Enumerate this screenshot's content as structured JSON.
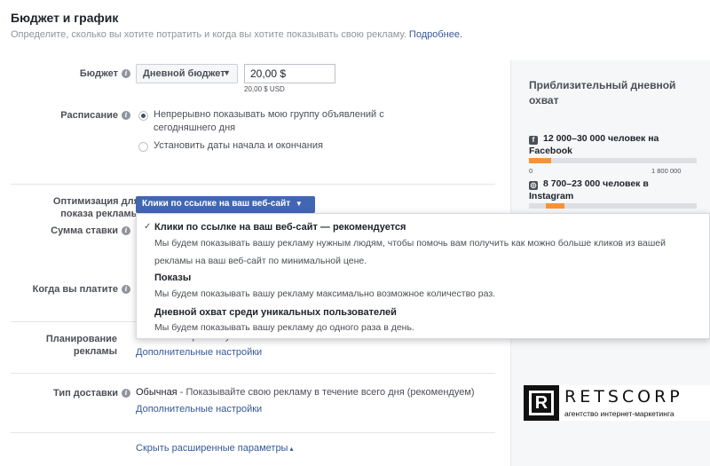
{
  "header": {
    "title": "Бюджет и график",
    "description": "Определите, сколько вы хотите потратить и когда вы хотите показывать свою рекламу.",
    "learn_more": "Подробнее."
  },
  "budget": {
    "label": "Бюджет",
    "type_selected": "Дневной бюджет",
    "amount": "20,00 $",
    "amount_usd": "20,00 $ USD"
  },
  "schedule": {
    "label": "Расписание",
    "options": [
      {
        "line1": "Непрерывно показывать мою группу объявлений с",
        "line2": "сегодняшнего дня",
        "selected": true
      },
      {
        "line1": "Установить даты начала и окончания",
        "selected": false
      }
    ]
  },
  "optimization": {
    "label_line1": "Оптимизация для",
    "label_line2": "показа рекламы",
    "selected": "Клики по ссылке на ваш веб-сайт",
    "dropdown": [
      {
        "check": "✓",
        "title": "Клики по ссылке на ваш веб-сайт — рекомендуется",
        "desc_line1": "Мы будем показывать вашу рекламу нужным людям, чтобы помочь вам получить как можно больше кликов из вашей",
        "desc_line2": "рекламы на ваш веб-сайт по минимальной цене."
      },
      {
        "title": "Показы",
        "desc_line1": "Мы будем показывать вашу рекламу максимально возможное количество раз."
      },
      {
        "title": "Дневной охват среди уникальных пользователей",
        "desc_line1": "Мы будем показывать вашу рекламу до одного раза в день."
      }
    ]
  },
  "bid": {
    "label": "Сумма ставки"
  },
  "charge": {
    "label": "Когда вы платите"
  },
  "ad_scheduling": {
    "label_line1": "Планирование",
    "label_line2": "рекламы",
    "partial_text": "Показывать рекламу постоянно",
    "more_settings": "Дополнительные настройки"
  },
  "delivery": {
    "label": "Тип доставки",
    "value_bold": "Обычная",
    "value_rest": "- Показывайте свою рекламу в течение всего дня (рекомендуем)",
    "more_settings": "Дополнительные настройки"
  },
  "hide_advanced": "Скрыть расширенные параметры",
  "hide_advanced_caret": "▴",
  "reach": {
    "title": "Приблизительный дневной охват",
    "platforms": [
      {
        "icon": "f",
        "text_line1": "12 000–30 000 человек на",
        "text_line2": "Facebook",
        "bar_start": 0.0,
        "bar_end": 0.13,
        "min": "0",
        "max": "1 800 000"
      },
      {
        "icon": "◎",
        "text_line1": "8 700–23 000 человек в",
        "text_line2": "Instagram",
        "bar_start": 0.1,
        "bar_end": 0.21
      }
    ]
  },
  "logo": {
    "letter": "R",
    "name": "RETSCORP",
    "tagline": "агентство интернет-маркетинга"
  },
  "colors": {
    "accent": "#4267b2",
    "link": "#365899",
    "bar_fill": "#f7923a"
  }
}
